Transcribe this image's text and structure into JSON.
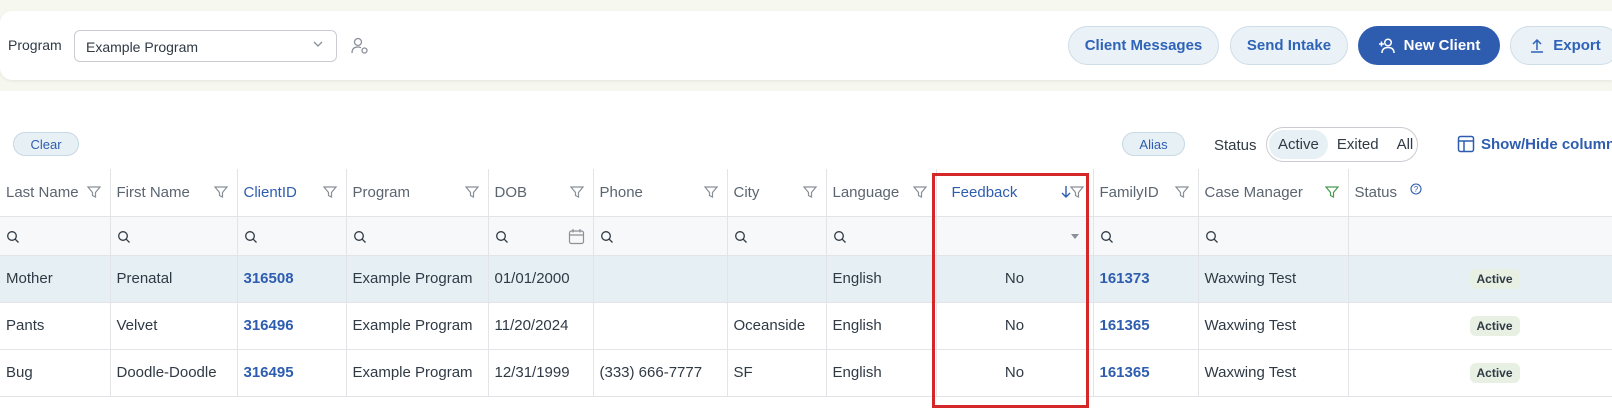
{
  "toolbar": {
    "program_label": "Program",
    "program_value": "Example Program",
    "client_messages": "Client Messages",
    "send_intake": "Send Intake",
    "new_client": "New Client",
    "export": "Export"
  },
  "filters": {
    "clear": "Clear",
    "alias": "Alias",
    "status_label": "Status",
    "status_options": [
      "Active",
      "Exited",
      "All"
    ],
    "status_selected": "Active",
    "show_hide": "Show/Hide columns"
  },
  "table": {
    "columns": [
      "Last Name",
      "First Name",
      "ClientID",
      "Program",
      "DOB",
      "Phone",
      "City",
      "Language",
      "Feedback",
      "FamilyID",
      "Case Manager",
      "Status"
    ],
    "rows": [
      {
        "last": "Mother",
        "first": "Prenatal",
        "client_id": "316508",
        "program": "Example Program",
        "dob": "01/01/2000",
        "phone": "",
        "city": "",
        "language": "English",
        "feedback": "No",
        "family_id": "161373",
        "case_manager": "Waxwing Test",
        "status": "Active"
      },
      {
        "last": "Pants",
        "first": "Velvet",
        "client_id": "316496",
        "program": "Example Program",
        "dob": "11/20/2024",
        "phone": "",
        "city": "Oceanside",
        "language": "English",
        "feedback": "No",
        "family_id": "161365",
        "case_manager": "Waxwing Test",
        "status": "Active"
      },
      {
        "last": "Bug",
        "first": "Doodle-Doodle",
        "client_id": "316495",
        "program": "Example Program",
        "dob": "12/31/1999",
        "phone": "(333) 666-7777",
        "city": "SF",
        "language": "English",
        "feedback": "No",
        "family_id": "161365",
        "case_manager": "Waxwing Test",
        "status": "Active"
      }
    ]
  },
  "colors": {
    "accent": "#2e5db0",
    "highlight_box": "#d42727",
    "selected_row": "#e6f0f4"
  }
}
